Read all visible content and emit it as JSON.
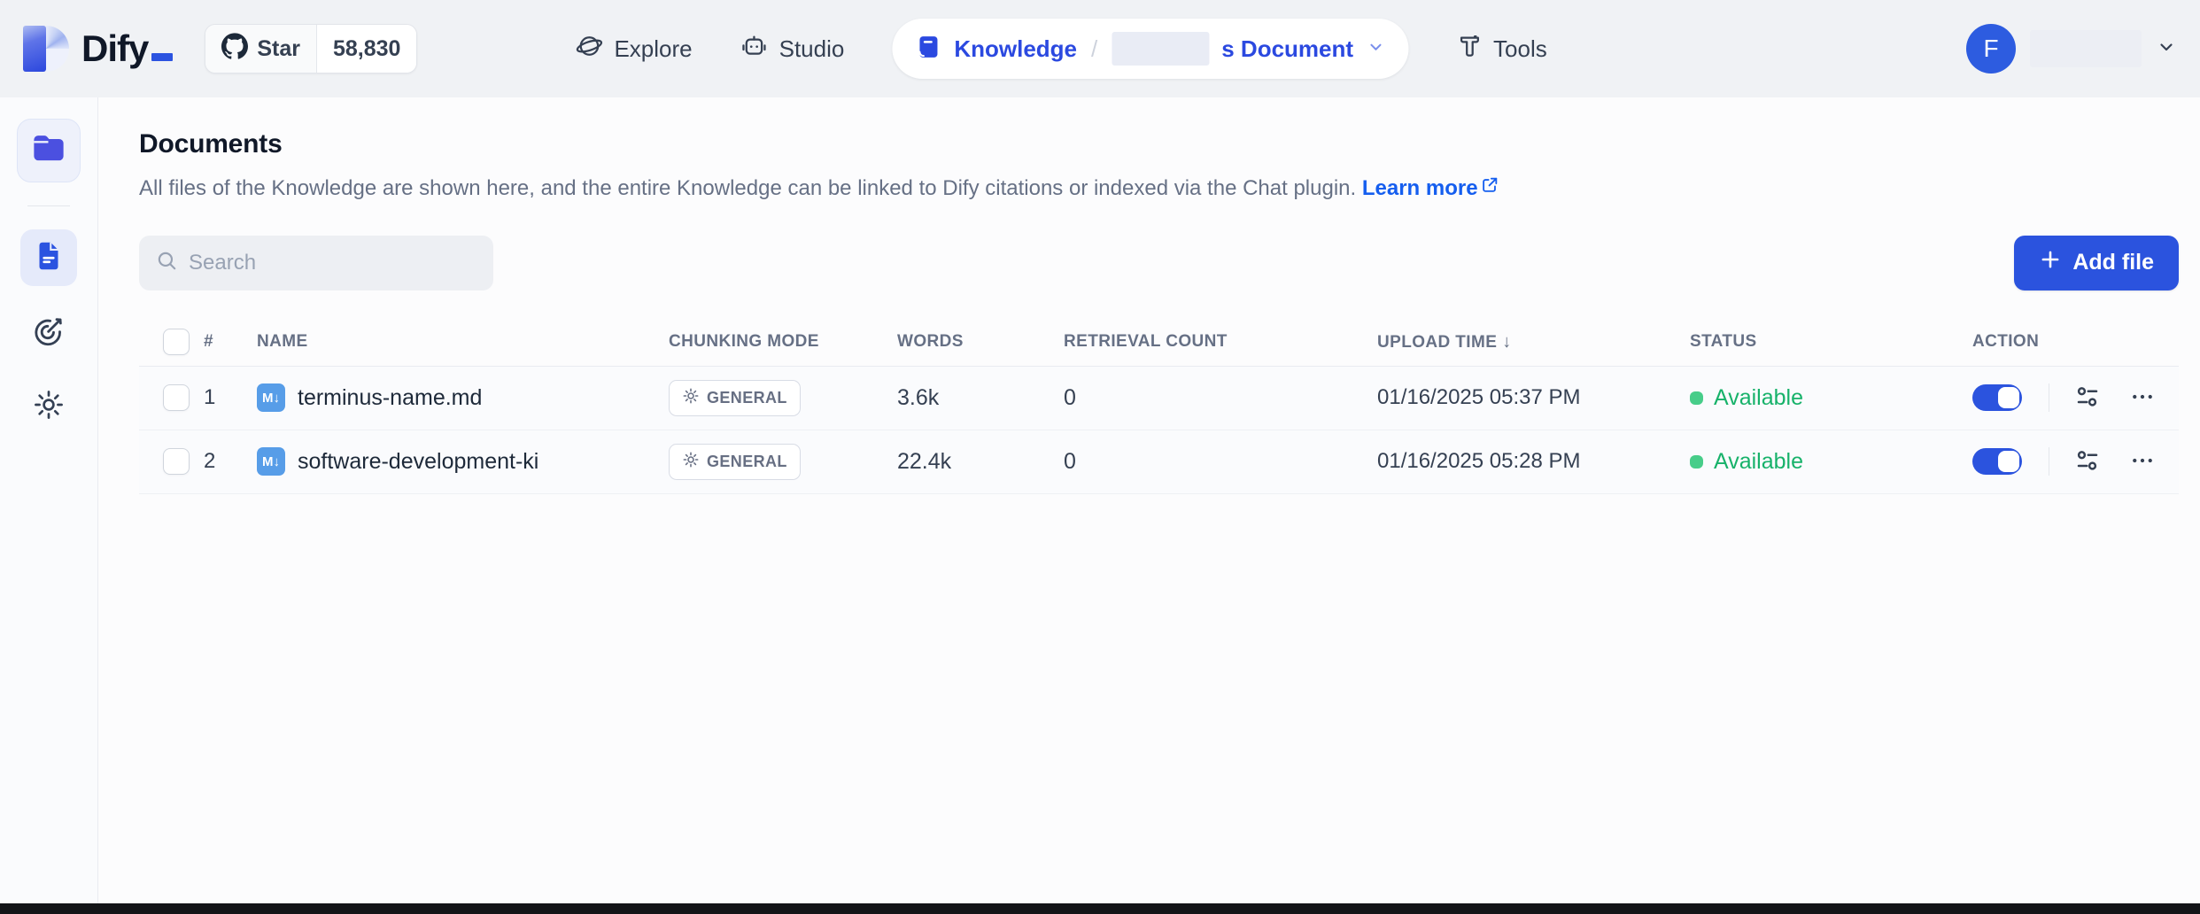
{
  "nav": {
    "logo_text": "Dify",
    "github": {
      "star_label": "Star",
      "star_count": "58,830"
    },
    "explore_label": "Explore",
    "studio_label": "Studio",
    "tools_label": "Tools",
    "breadcrumb": {
      "section_label": "Knowledge",
      "separator": "/",
      "current_visible_text": "s Document"
    },
    "account": {
      "avatar_initial": "F"
    }
  },
  "sidebar": {
    "items": [
      {
        "icon": "knowledge-folder",
        "active": false
      },
      {
        "icon": "documents",
        "active": true
      },
      {
        "icon": "hit-testing",
        "active": false
      },
      {
        "icon": "settings",
        "active": false
      }
    ]
  },
  "main": {
    "title": "Documents",
    "description": "All files of the Knowledge are shown here, and the entire Knowledge can be linked to Dify citations or indexed via the Chat plugin.",
    "learn_more_label": "Learn more",
    "search_placeholder": "Search",
    "add_file_label": "Add file"
  },
  "table": {
    "columns": {
      "index": "#",
      "name": "NAME",
      "chunking_mode": "CHUNKING MODE",
      "words": "WORDS",
      "retrieval_count": "RETRIEVAL COUNT",
      "upload_time": "UPLOAD TIME",
      "status": "STATUS",
      "action": "ACTION"
    },
    "sort_indicator": "↓",
    "md_badge_text": "M↓",
    "rows": [
      {
        "index": "1",
        "name": "terminus-name.md",
        "chunking_mode": "GENERAL",
        "words": "3.6k",
        "retrieval_count": "0",
        "upload_time": "01/16/2025 05:37 PM",
        "status": "Available",
        "enabled": true
      },
      {
        "index": "2",
        "name": "software-development-ki",
        "chunking_mode": "GENERAL",
        "words": "22.4k",
        "retrieval_count": "0",
        "upload_time": "01/16/2025 05:28 PM",
        "status": "Available",
        "enabled": true
      }
    ]
  }
}
